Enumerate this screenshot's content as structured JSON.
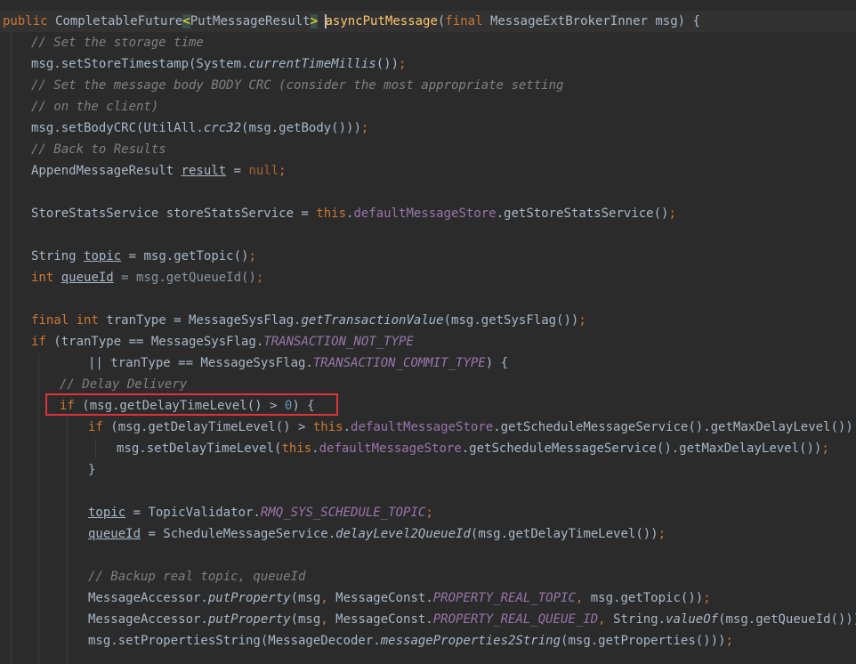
{
  "code": {
    "l1": {
      "mod": "public",
      "type": "CompletableFuture",
      "lt": "<",
      "generic": "PutMessageResult",
      "gt": ">",
      "method": "asyncPutMessage",
      "paren": "(",
      "final": "final",
      "param": " MessageExtBrokerInner msg) {"
    },
    "l2": "// Set the storage time",
    "l3": {
      "a": "msg.setStoreTimestamp(System.",
      "b": "currentTimeMillis",
      "c": "())",
      "d": ";"
    },
    "l4": "// Set the message body BODY CRC (consider the most appropriate setting",
    "l5": "// on the client)",
    "l6": {
      "a": "msg.setBodyCRC(UtilAll.",
      "b": "crc32",
      "c": "(msg.getBody()))",
      "d": ";"
    },
    "l7": "// Back to Results",
    "l8": {
      "a": "AppendMessageResult ",
      "b": "result",
      "c": " = ",
      "d": "null",
      "e": ";"
    },
    "l10": {
      "a": "StoreStatsService storeStatsService = ",
      "b": "this",
      "c": ".",
      "d": "defaultMessageStore",
      "e": ".getStoreStatsService()",
      "f": ";"
    },
    "l12": {
      "a": "String ",
      "b": "topic",
      "c": " = msg.getTopic()",
      "d": ";"
    },
    "l13": {
      "a": "int",
      "b": " ",
      "c": "queueId",
      "d": " = msg.getQueueId()",
      "e": ";"
    },
    "l15": {
      "a": "final",
      "b": " ",
      "c": "int",
      "d": " tranType = MessageSysFlag.",
      "e": "getTransactionValue",
      "f": "(msg.getSysFlag())",
      "g": ";"
    },
    "l16": {
      "a": "if",
      "b": " (tranType == MessageSysFlag.",
      "c": "TRANSACTION_NOT_TYPE"
    },
    "l17": {
      "a": "|| tranType == MessageSysFlag.",
      "b": "TRANSACTION_COMMIT_TYPE",
      "c": ") {"
    },
    "l18": "// Delay Delivery",
    "l19": {
      "a": "if",
      "b": " (msg.getDelayTimeLevel() > ",
      "c": "0",
      "d": ") {"
    },
    "l20": {
      "a": "if",
      "b": " (msg.getDelayTimeLevel() > ",
      "c": "this",
      "d": ".",
      "e": "defaultMessageStore",
      "f": ".getScheduleMessageService().getMaxDelayLevel()) {"
    },
    "l21": {
      "a": "msg.setDelayTimeLevel(",
      "b": "this",
      "c": ".",
      "d": "defaultMessageStore",
      "e": ".getScheduleMessageService().getMaxDelayLevel())",
      "f": ";"
    },
    "l22": "}",
    "l24": {
      "a": "topic",
      "b": " = TopicValidator.",
      "c": "RMQ_SYS_SCHEDULE_TOPIC",
      "d": ";"
    },
    "l25": {
      "a": "queueId",
      "b": " = ScheduleMessageService.",
      "c": "delayLevel2QueueId",
      "d": "(msg.getDelayTimeLevel())",
      "e": ";"
    },
    "l27": "// Backup real topic, queueId",
    "l28": {
      "a": "MessageAccessor.",
      "b": "putProperty",
      "c": "(msg",
      "d": ", ",
      "e": "MessageConst.",
      "f": "PROPERTY_REAL_TOPIC",
      "g": ", ",
      "h": "msg.getTopic())",
      "i": ";"
    },
    "l29": {
      "a": "MessageAccessor.",
      "b": "putProperty",
      "c": "(msg",
      "d": ", ",
      "e": "MessageConst.",
      "f": "PROPERTY_REAL_QUEUE_ID",
      "g": ", ",
      "h": "String.",
      "i": "valueOf",
      "j": "(msg.getQueueId()))",
      "k": ";"
    },
    "l30": {
      "a": "msg.setPropertiesString(MessageDecoder.",
      "b": "messageProperties2String",
      "c": "(msg.getProperties()))",
      "d": ";"
    }
  },
  "colors": {
    "background": "#2b2b2b",
    "highlight_box": "#e0323a"
  }
}
